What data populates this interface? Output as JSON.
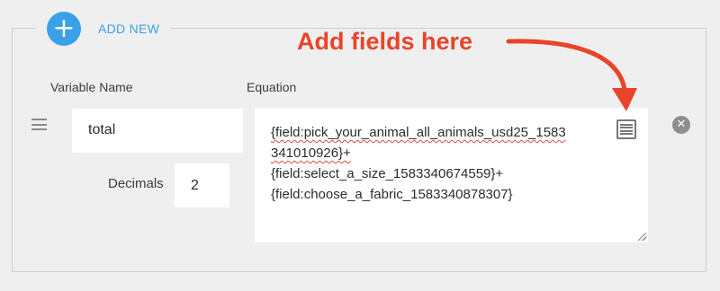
{
  "add_new": {
    "icon": "plus-icon",
    "label": "ADD NEW"
  },
  "columns": {
    "variable_name": "Variable Name",
    "equation": "Equation"
  },
  "row": {
    "variable_name": "total",
    "decimals_label": "Decimals",
    "decimals_value": "2",
    "equation_lines": [
      "{field:pick_your_animal_all_animals_usd25_1583",
      "341010926}+",
      "{field:select_a_size_1583340674559}+",
      "{field:choose_a_fabric_1583340878307}"
    ]
  },
  "icons": {
    "drag": "drag-handle-icon",
    "field_list": "field-list-icon",
    "remove": "remove-icon"
  },
  "annotation": {
    "text": "Add fields here",
    "color": "#e9442a"
  },
  "colors": {
    "accent": "#3aa1e6",
    "background": "#efefef"
  }
}
